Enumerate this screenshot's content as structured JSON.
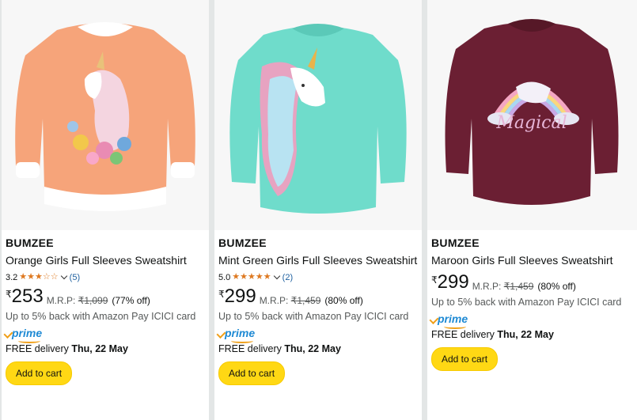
{
  "products": [
    {
      "brand": "BUMZEE",
      "title": "Orange Girls Full Sleeves Sweatshirt",
      "rating": "3.2",
      "stars_filled": 3,
      "review_count": "(5)",
      "currency": "₹",
      "price": "253",
      "mrp_label": "M.R.P:",
      "mrp": "₹1,099",
      "discount": "(77% off)",
      "cashback": "Up to 5% back with Amazon Pay ICICI card",
      "prime_label": "prime",
      "delivery_prefix": "FREE delivery",
      "delivery_date": "Thu, 22 May",
      "cart_label": "Add to cart",
      "image_icon": "orange-sweatshirt-unicorn-image",
      "color": "#f6a47a"
    },
    {
      "brand": "BUMZEE",
      "title": "Mint Green Girls Full Sleeves Sweatshirt",
      "rating": "5.0",
      "stars_filled": 5,
      "review_count": "(2)",
      "currency": "₹",
      "price": "299",
      "mrp_label": "M.R.P:",
      "mrp": "₹1,459",
      "discount": "(80% off)",
      "cashback": "Up to 5% back with Amazon Pay ICICI card",
      "prime_label": "prime",
      "delivery_prefix": "FREE delivery",
      "delivery_date": "Thu, 22 May",
      "cart_label": "Add to cart",
      "image_icon": "mint-sweatshirt-unicorn-image",
      "color": "#6fdccb"
    },
    {
      "brand": "BUMZEE",
      "title": "Maroon Girls Full Sleeves Sweatshirt",
      "currency": "₹",
      "price": "299",
      "mrp_label": "M.R.P:",
      "mrp": "₹1,459",
      "discount": "(80% off)",
      "cashback": "Up to 5% back with Amazon Pay ICICI card",
      "prime_label": "prime",
      "delivery_prefix": "FREE delivery",
      "delivery_date": "Thu, 22 May",
      "cart_label": "Add to cart",
      "image_icon": "maroon-sweatshirt-unicorn-image",
      "image_text": "Magical",
      "color": "#6b1f33"
    }
  ],
  "colors": {
    "button": "#ffd814",
    "star": "#de7921",
    "link": "#2162a1",
    "prime": "#1f8ad4"
  }
}
